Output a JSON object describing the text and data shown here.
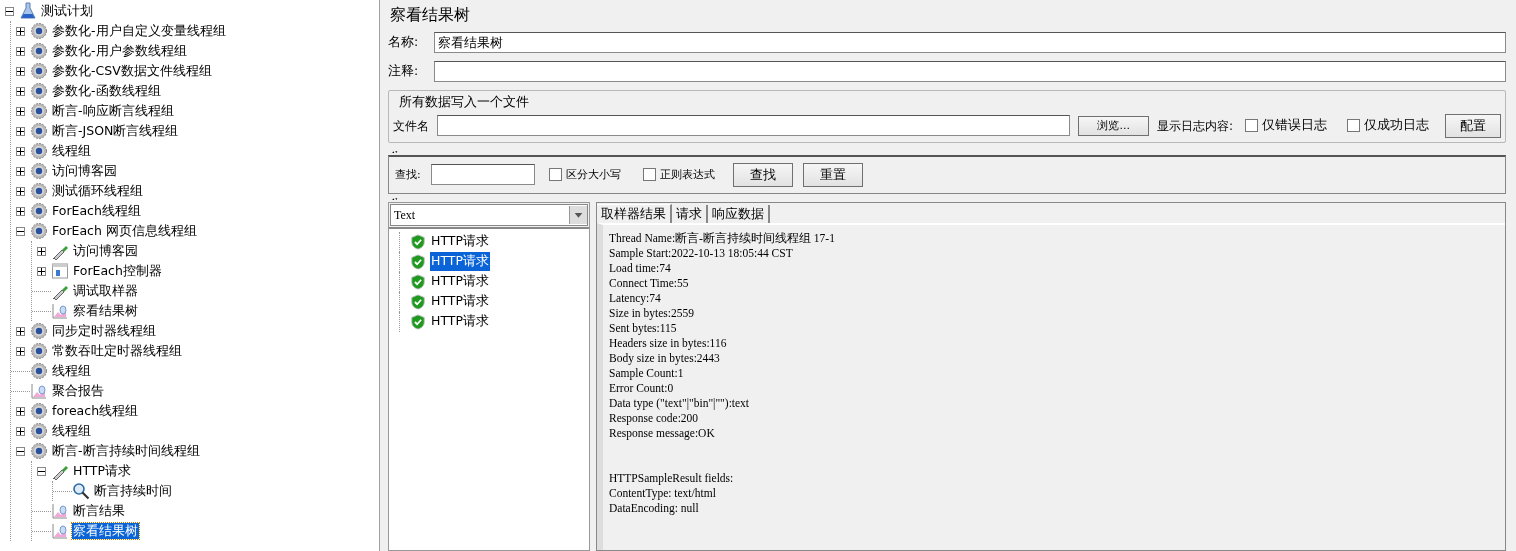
{
  "tree": [
    {
      "label": "测试计划",
      "kind": "plan",
      "expanded": true,
      "selected": false,
      "children": [
        {
          "label": "参数化-用户自定义变量线程组",
          "kind": "thread-group",
          "expanded": false,
          "selected": false
        },
        {
          "label": "参数化-用户参数线程组",
          "kind": "thread-group",
          "expanded": false,
          "selected": false
        },
        {
          "label": "参数化-CSV数据文件线程组",
          "kind": "thread-group",
          "expanded": false,
          "selected": false
        },
        {
          "label": "参数化-函数线程组",
          "kind": "thread-group",
          "expanded": false,
          "selected": false
        },
        {
          "label": "断言-响应断言线程组",
          "kind": "thread-group",
          "expanded": false,
          "selected": false
        },
        {
          "label": "断言-JSON断言线程组",
          "kind": "thread-group",
          "expanded": false,
          "selected": false
        },
        {
          "label": "线程组",
          "kind": "thread-group",
          "expanded": false,
          "selected": false
        },
        {
          "label": "访问博客园",
          "kind": "thread-group",
          "expanded": false,
          "selected": false
        },
        {
          "label": "测试循环线程组",
          "kind": "thread-group",
          "expanded": false,
          "selected": false
        },
        {
          "label": "ForEach线程组",
          "kind": "thread-group",
          "expanded": false,
          "selected": false
        },
        {
          "label": "ForEach 网页信息线程组",
          "kind": "thread-group",
          "expanded": true,
          "selected": false,
          "children": [
            {
              "label": "访问博客园",
              "kind": "sampler",
              "expanded": false,
              "selected": false
            },
            {
              "label": "ForEach控制器",
              "kind": "controller",
              "expanded": false,
              "selected": false
            },
            {
              "label": "调试取样器",
              "kind": "sampler",
              "selected": false
            },
            {
              "label": "察看结果树",
              "kind": "listener",
              "selected": false
            }
          ]
        },
        {
          "label": "同步定时器线程组",
          "kind": "thread-group",
          "expanded": false,
          "selected": false
        },
        {
          "label": "常数吞吐定时器线程组",
          "kind": "thread-group",
          "expanded": false,
          "selected": false
        },
        {
          "label": "线程组",
          "kind": "thread-group",
          "selected": false
        },
        {
          "label": "聚合报告",
          "kind": "listener",
          "selected": false
        },
        {
          "label": "foreach线程组",
          "kind": "thread-group",
          "expanded": false,
          "selected": false
        },
        {
          "label": "线程组",
          "kind": "thread-group",
          "expanded": false,
          "selected": false
        },
        {
          "label": "断言-断言持续时间线程组",
          "kind": "thread-group",
          "expanded": true,
          "selected": false,
          "children": [
            {
              "label": "HTTP请求",
              "kind": "sampler",
              "expanded": true,
              "selected": false,
              "children": [
                {
                  "label": "断言持续时间",
                  "kind": "assertion",
                  "selected": false
                }
              ]
            },
            {
              "label": "断言结果",
              "kind": "listener",
              "selected": false
            },
            {
              "label": "察看结果树",
              "kind": "listener",
              "selected": true
            }
          ]
        }
      ]
    }
  ],
  "panel": {
    "title": "察看结果树",
    "name": {
      "label": "名称:",
      "value": "察看结果树"
    },
    "comment": {
      "label": "注释:"
    },
    "file_group": {
      "legend": "所有数据写入一个文件",
      "file_label": "文件名",
      "browse_button": "浏览...",
      "log_label": "显示日志内容:",
      "checkboxes": [
        {
          "label": "仅错误日志",
          "checked": false
        },
        {
          "label": "仅成功日志",
          "checked": false
        }
      ],
      "config_button": "配置"
    },
    "search": {
      "label": "查找:",
      "checkboxes": [
        {
          "label": "区分大小写",
          "checked": false
        },
        {
          "label": "正则表达式",
          "checked": false
        }
      ],
      "buttons": [
        "查找",
        "重置"
      ]
    },
    "renderer": {
      "value": "Text"
    },
    "results": [
      {
        "label": "HTTP请求",
        "selected": false
      },
      {
        "label": "HTTP请求",
        "selected": true
      },
      {
        "label": "HTTP请求",
        "selected": false
      },
      {
        "label": "HTTP请求",
        "selected": false
      },
      {
        "label": "HTTP请求",
        "selected": false
      }
    ],
    "tabs": [
      {
        "label": "取样器结果",
        "selected": true
      },
      {
        "label": "请求",
        "selected": false
      },
      {
        "label": "响应数据",
        "selected": false
      }
    ],
    "result_lines": [
      "Thread Name:断言-断言持续时间线程组 17-1",
      "Sample Start:2022-10-13 18:05:44 CST",
      "Load time:74",
      "Connect Time:55",
      "Latency:74",
      "Size in bytes:2559",
      "Sent bytes:115",
      "Headers size in bytes:116",
      "Body size in bytes:2443",
      "Sample Count:1",
      "Error Count:0",
      "Data type (\"text\"|\"bin\"|\"\"):text",
      "Response code:200",
      "Response message:OK"
    ],
    "field_lines": [
      "HTTPSampleResult fields:",
      "ContentType: text/html",
      "DataEncoding: null"
    ]
  }
}
